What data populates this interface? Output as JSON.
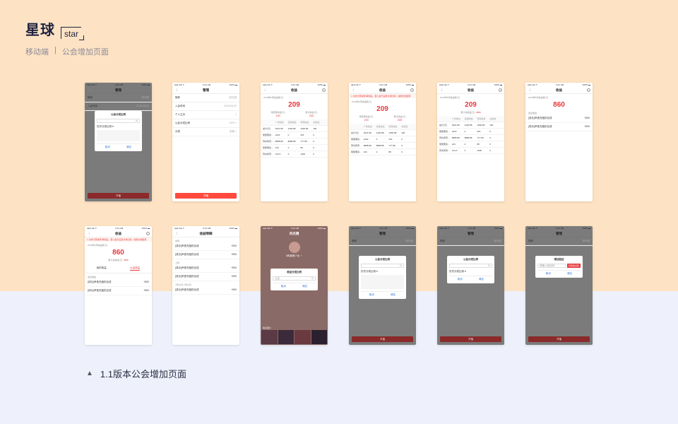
{
  "header": {
    "title": "星球",
    "tag": "star",
    "platform": "移动端",
    "separator": "|",
    "section": "公会增加页面"
  },
  "caption": {
    "marker": "▲",
    "text": "1.1版本公会增加页面"
  },
  "screens": {
    "manage": {
      "title": "管理",
      "back": "〈",
      "submit": "开播",
      "rows": [
        {
          "label": "昵称",
          "value": "风光镜"
        },
        {
          "label": "入会时间",
          "value": "2018-08-30"
        },
        {
          "label": "个人主页",
          "value": ">"
        },
        {
          "label": "公会分成比例",
          "value": "30% >"
        },
        {
          "label": "分成",
          "value": "查看 >"
        }
      ]
    },
    "ratio_modal": {
      "title": "公会分成比例",
      "unit": "%",
      "history": "历史分成比例 ▾",
      "cancel": "取消",
      "confirm": "确定"
    },
    "earnings": {
      "title": "收益",
      "date_label": "2018年8月收益额(元)",
      "month_value": "209",
      "total_value": "860",
      "total_label": "累计总收益(元):",
      "total_num": "6888",
      "alert": "1.分成计算说明 审核后。若公会已设置分成比例，将按比例结算",
      "left_label": "待结算收益(元)",
      "left_value": "190",
      "right_label": "累计收益(元)",
      "right_value": "330",
      "table_head": [
        "",
        "广告收益",
        "直播收益",
        "营收收益",
        "总收益"
      ],
      "table_rows": [
        [
          "总计(元)",
          "3021.88",
          "4190.88",
          "1669.88",
          "100"
        ],
        [
          "侃侃而谈...",
          "1023",
          "0",
          "254",
          "0"
        ],
        [
          "苏州风景...",
          "8888.88",
          "8888.88",
          "777.88",
          "0"
        ],
        [
          "侃侃而谈...",
          "244",
          "0",
          "88",
          "0"
        ],
        [
          "苏州风景...",
          "124.5",
          "0",
          "1000",
          "0"
        ]
      ]
    },
    "record": {
      "title": "收益明细",
      "sections": [
        {
          "head": "本周",
          "items": [
            {
              "name": "[成长]声音充值的合成",
              "amount": "+500"
            },
            {
              "name": "[成长]声音充值的合成",
              "amount": "+500"
            }
          ]
        },
        {
          "head": "上周",
          "items": [
            {
              "name": "[成长]声音充值的合成",
              "amount": "+500"
            },
            {
              "name": "[成长]声音充值的合成",
              "amount": "+500"
            }
          ]
        },
        {
          "head": "7月23日-7月29日",
          "items": [
            {
              "name": "[成长]声音充值的合成",
              "amount": "+500"
            }
          ]
        }
      ]
    },
    "earnings_tabs": {
      "tab1": "我的收益",
      "tab2": "公会收益",
      "list_head": "最近收益",
      "items": [
        {
          "name": "[成长]声音充值的合成",
          "amount": "+500"
        },
        {
          "name": "[成长]声音充值的合成",
          "amount": "+500"
        }
      ]
    },
    "profile": {
      "title": "风光镜",
      "nickname": "#风景美少女 ♀",
      "modal_title": "收益分成比例",
      "modal_field": "公会",
      "photos_label": "相关图片"
    },
    "verify_modal": {
      "title": "增加验证",
      "placeholder": "请输入验证码",
      "get_code": "获取验证码",
      "cancel": "取消",
      "confirm": "确定"
    },
    "status_left": "●●● GE ✈",
    "status_time": "9:41 AM",
    "status_right": "100% ▬"
  }
}
